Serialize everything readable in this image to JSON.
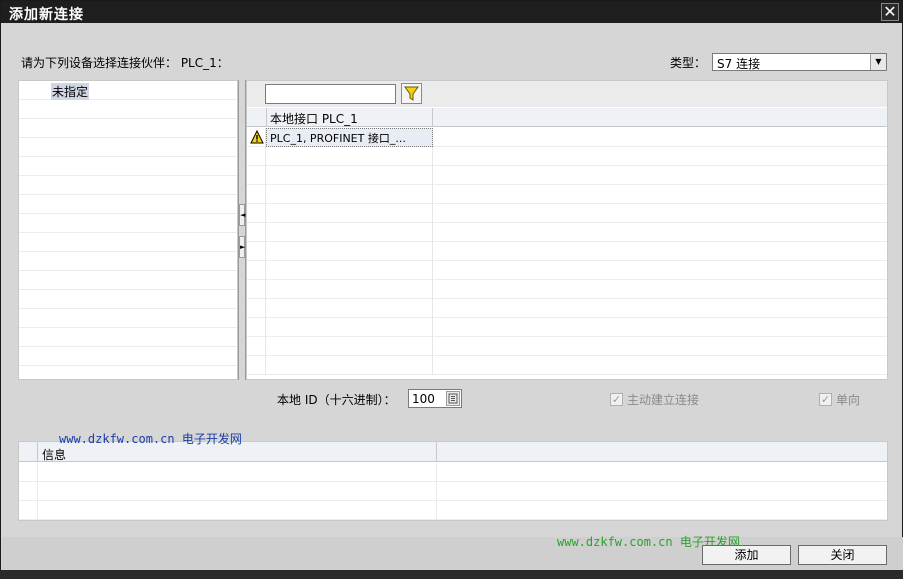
{
  "window": {
    "title": "添加新连接",
    "close_glyph": "✕"
  },
  "prompt": "请为下列设备选择连接伙伴： PLC_1：",
  "type_select": {
    "label": "类型：",
    "value": "S7 连接",
    "arrow": "▼"
  },
  "left_tree": {
    "selected_label": "未指定"
  },
  "splitter": {
    "collapse_left": "◄",
    "expand_right": "►"
  },
  "filter": {
    "value": "",
    "icon": "funnel-icon"
  },
  "interface_table": {
    "header": "本地接口 PLC_1",
    "rows": [
      {
        "status_icon": "warning-icon",
        "label": "PLC_1, PROFINET 接口_..."
      }
    ]
  },
  "local_id": {
    "label": "本地 ID（十六进制）：",
    "value": "100"
  },
  "options": {
    "active_connection": {
      "label": "主动建立连接",
      "checked": true,
      "enabled": false
    },
    "one_way": {
      "label": "单向",
      "checked": true,
      "enabled": false
    }
  },
  "info_table": {
    "header": "信息"
  },
  "watermarks": {
    "top": "www.dzkfw.com.cn 电子开发网",
    "bottom": "www.dzkfw.com.cn 电子开发网"
  },
  "buttons": {
    "add": "添加",
    "close": "关闭"
  },
  "colors": {
    "titlebar": "#1e1e1e",
    "warning": "#f3d20f",
    "watermark_blue": "#1a3ea8",
    "watermark_green": "#2aa22a"
  }
}
